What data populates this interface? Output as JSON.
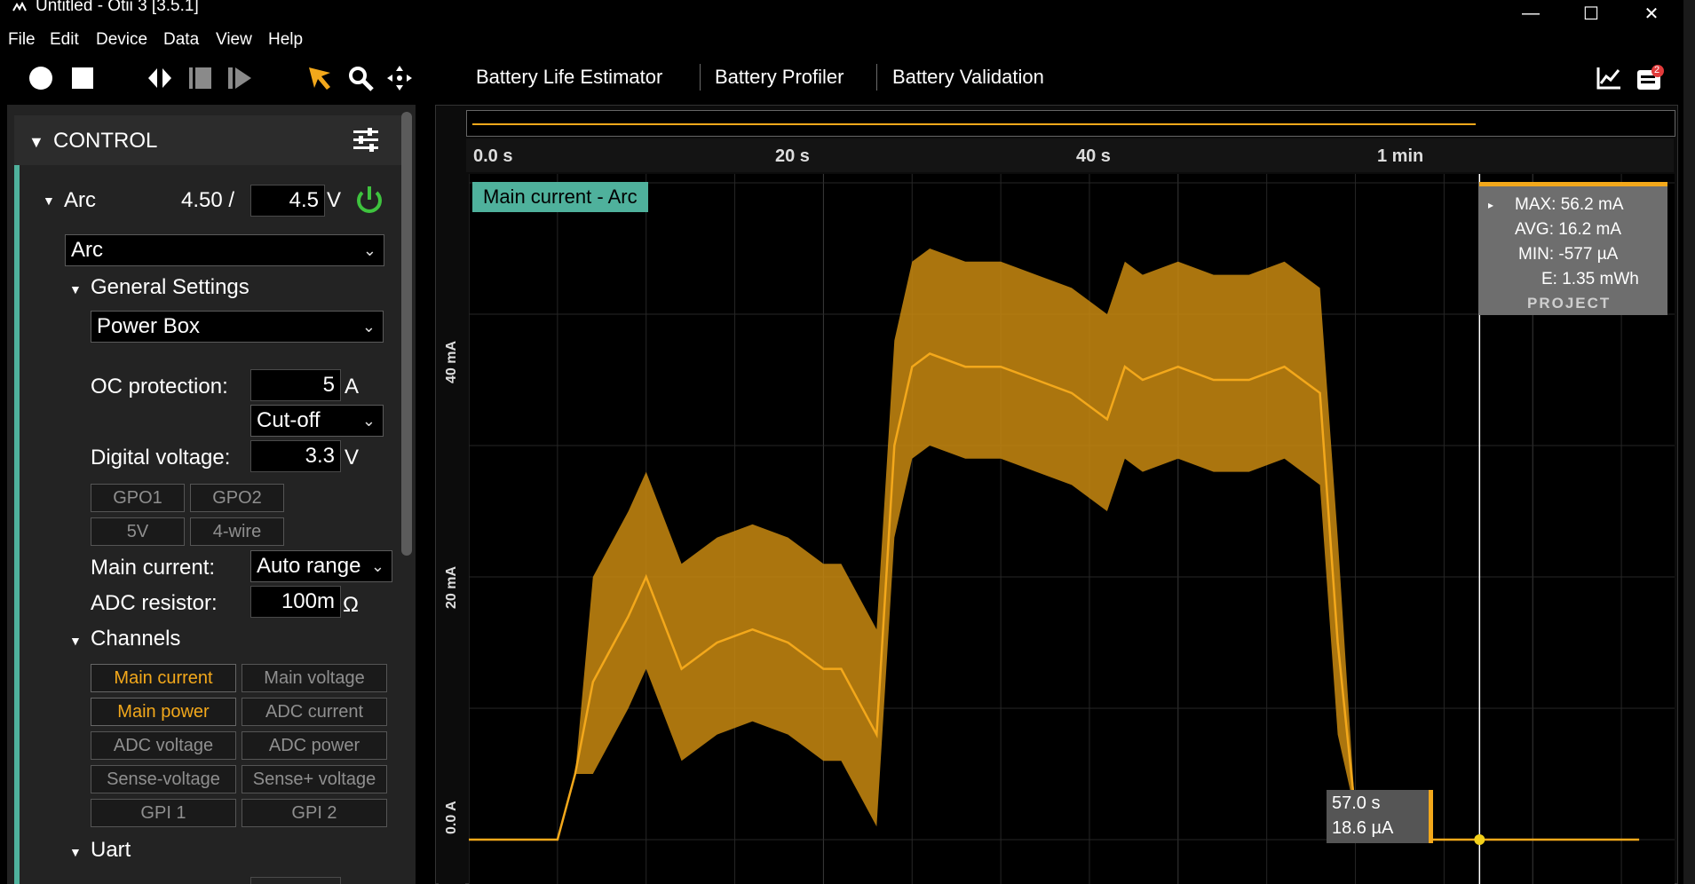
{
  "window": {
    "title": "Untitled - Otii 3 [3.5.1]",
    "controls": [
      "—",
      "☐",
      "✕"
    ]
  },
  "menu": [
    "File",
    "Edit",
    "Device",
    "Data",
    "View",
    "Help"
  ],
  "toolbar": {
    "icons": [
      "record-icon",
      "stop-icon",
      "split-icon",
      "fit-icon",
      "play-next-icon",
      "pointer-icon",
      "zoom-icon",
      "pan-icon",
      "chart-icon",
      "notifications-icon"
    ],
    "notification_count": "2",
    "tabs": [
      "Battery Life Estimator",
      "Battery Profiler",
      "Battery Validation"
    ]
  },
  "control": {
    "header": "CONTROL",
    "device": {
      "name": "Arc",
      "voltage_set": "4.50 /",
      "voltage_input": "4.5",
      "voltage_unit": "V",
      "selected": "Arc"
    },
    "general_settings": {
      "title": "General Settings",
      "power_source": "Power Box",
      "oc_label": "OC protection:",
      "oc_value": "5",
      "oc_unit": "A",
      "oc_mode": "Cut-off",
      "dv_label": "Digital voltage:",
      "dv_value": "3.3",
      "dv_unit": "V",
      "io_buttons": [
        "GPO1",
        "GPO2",
        "5V",
        "4-wire"
      ],
      "main_current_label": "Main current:",
      "main_current_value": "Auto range",
      "adc_label": "ADC resistor:",
      "adc_value": "100m",
      "adc_unit": "Ω"
    },
    "channels": {
      "title": "Channels",
      "buttons": [
        {
          "label": "Main current",
          "on": true
        },
        {
          "label": "Main voltage",
          "on": false
        },
        {
          "label": "Main power",
          "on": true
        },
        {
          "label": "ADC current",
          "on": false
        },
        {
          "label": "ADC voltage",
          "on": false
        },
        {
          "label": "ADC power",
          "on": false
        },
        {
          "label": "Sense-voltage",
          "on": false
        },
        {
          "label": "Sense+ voltage",
          "on": false
        },
        {
          "label": "GPI 1",
          "on": false
        },
        {
          "label": "GPI 2",
          "on": false
        }
      ]
    },
    "uart": {
      "title": "Uart"
    }
  },
  "plot": {
    "legend": "Main current - Arc",
    "time_ticks": [
      "0.0 s",
      "20 s",
      "40 s",
      "1 min"
    ],
    "y_ticks": [
      "0.0 A",
      "20 mA",
      "40 mA"
    ],
    "stats": {
      "max": "MAX:  56.2 mA",
      "avg": "AVG:  16.2 mA",
      "min": "MIN:  -577 µA",
      "energy": "E:  1.35 mWh",
      "label": "PROJECT"
    },
    "cursor": {
      "time": "57.0 s",
      "value": "18.6 µA"
    },
    "colors": {
      "trace": "#f3a81b",
      "legend_bg": "#4fb19c"
    }
  },
  "chart_data": {
    "type": "line",
    "xlabel": "",
    "ylabel": "",
    "xlim": [
      0,
      68
    ],
    "ylim": [
      -1.5,
      50
    ],
    "series": [
      {
        "x": [
          0,
          5,
          6,
          7,
          9,
          10,
          12,
          14,
          16,
          18,
          19,
          20,
          21,
          23,
          24,
          25,
          26,
          28,
          30,
          32,
          34,
          36,
          37,
          38,
          40,
          42,
          44,
          46,
          48,
          49,
          50,
          51,
          52,
          57,
          60,
          66
        ],
        "values": [
          0,
          0,
          5,
          12,
          17,
          20,
          13,
          15,
          16,
          15,
          14,
          13,
          13,
          8,
          30,
          36,
          37,
          36,
          36,
          35,
          34,
          32,
          36,
          35,
          36,
          35,
          35,
          36,
          34,
          15,
          2,
          0,
          0,
          0,
          0,
          0
        ]
      }
    ]
  }
}
